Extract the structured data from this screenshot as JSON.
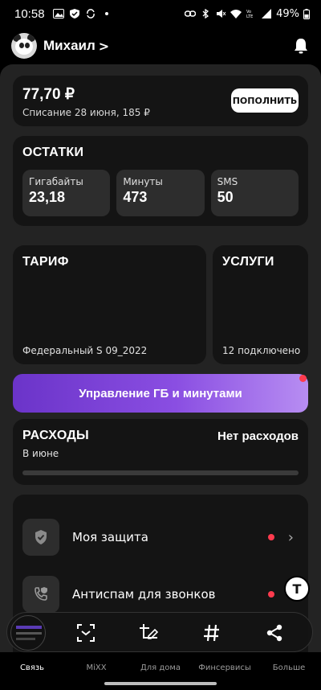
{
  "status_bar": {
    "time": "10:58",
    "battery": "49%",
    "icons_left": [
      "image-icon",
      "shield-icon",
      "sync-icon",
      "dot-icon"
    ],
    "icons_right": [
      "link-icon",
      "bluetooth-icon",
      "mute-icon",
      "wifi-icon",
      "volte-icon",
      "signal-icon"
    ]
  },
  "user": {
    "name": "Михаил",
    "chevron": ">"
  },
  "balance": {
    "amount": "77,70 ₽",
    "debit_note": "Списание 28 июня, 185 ₽",
    "topup_label": "ПОПОЛНИТЬ"
  },
  "remains": {
    "title": "ОСТАТКИ",
    "tiles": [
      {
        "label": "Гигабайты",
        "value": "23,18"
      },
      {
        "label": "Минуты",
        "value": "473"
      },
      {
        "label": "SMS",
        "value": "50"
      }
    ]
  },
  "tariff": {
    "title": "ТАРИФ",
    "name": "Федеральный S 09_2022"
  },
  "services": {
    "title": "УСЛУГИ",
    "connected": "12 подключено"
  },
  "manage_button": {
    "label": "Управление ГБ и минутами"
  },
  "expenses": {
    "title": "РАСХОДЫ",
    "value": "Нет расходов",
    "period": "В июне"
  },
  "service_list": [
    {
      "label": "Моя защита",
      "icon": "shield-check-icon"
    },
    {
      "label": "Антиспам для звонков",
      "icon": "phone-shield-icon"
    }
  ],
  "floating_button": {
    "label": "T"
  },
  "bottom_nav": [
    {
      "label": "Связь",
      "active": true
    },
    {
      "label": "MiXX",
      "active": false
    },
    {
      "label": "Для дома",
      "active": false
    },
    {
      "label": "Финсервисы",
      "active": false
    },
    {
      "label": "Больше",
      "active": false
    }
  ],
  "colors": {
    "background": "#232323",
    "card": "#141414",
    "tile": "#2d2d2d",
    "accent_gradient_start": "#6b34c9",
    "accent_gradient_end": "#b78df2",
    "notification_dot": "#ff3b4e"
  }
}
